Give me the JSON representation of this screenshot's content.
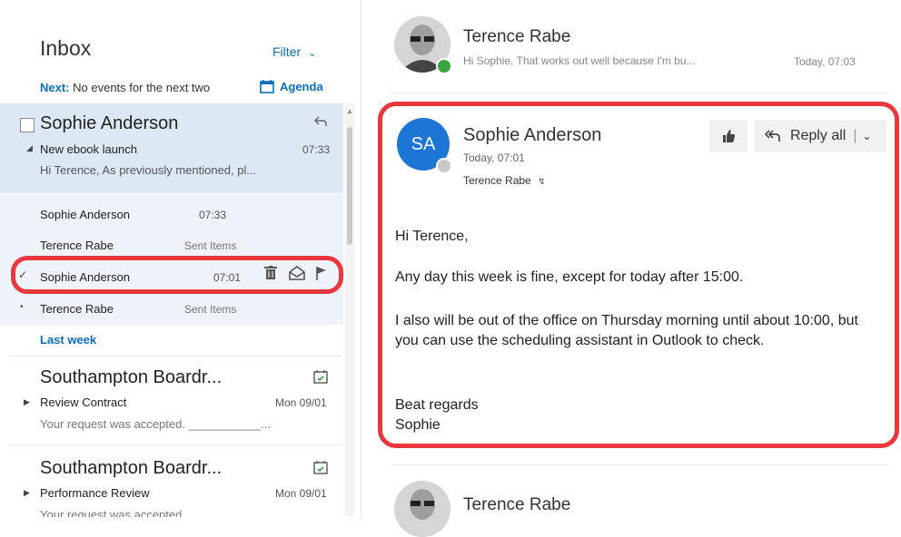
{
  "inbox": {
    "title": "Inbox",
    "filter_label": "Filter",
    "next_prefix": "Next:",
    "next_text": "No events for the next two",
    "agenda_label": "Agenda"
  },
  "conversation": {
    "sender": "Sophie Anderson",
    "subject": "New ebook launch",
    "time": "07:33",
    "preview": "Hi Terence,   As previously mentioned, pl...",
    "thread": [
      {
        "sender": "Sophie Anderson",
        "time": "07:33",
        "folder": ""
      },
      {
        "sender": "Terence Rabe",
        "time": "",
        "folder": "Sent Items"
      },
      {
        "sender": "Sophie Anderson",
        "time": "07:01",
        "folder": ""
      },
      {
        "sender": "Terence Rabe",
        "time": "",
        "folder": "Sent Items"
      }
    ]
  },
  "section_label": "Last week",
  "cards": [
    {
      "sender": "Southampton Boardr...",
      "subject": "Review Contract",
      "date": "Mon 09/01",
      "preview": "Your request was accepted. ___________..."
    },
    {
      "sender": "Southampton Boardr...",
      "subject": "Performance Review",
      "date": "Mon 09/01",
      "preview": "Your request was accepted"
    }
  ],
  "reading": {
    "top_message": {
      "sender": "Terence Rabe",
      "preview": "Hi Sophie, That works out well because I'm bu...",
      "date": "Today, 07:03"
    },
    "message": {
      "initials": "SA",
      "sender": "Sophie Anderson",
      "time": "Today, 07:01",
      "to": "Terence Rabe",
      "reply_all_label": "Reply all",
      "body": [
        "Hi Terence,",
        "Any day this week is fine, except for today after 15:00.",
        "I also will be out of the office on Thursday morning until about 10:00, but you can use the scheduling assistant in Outlook to check.",
        "Beat regards",
        "Sophie"
      ]
    },
    "bottom_message": {
      "sender": "Terence Rabe"
    }
  },
  "colors": {
    "accent": "#0b6ebd",
    "avatar_bg": "#1d76d6",
    "highlight": "#e8383d",
    "selected_bg": "#dce9f5",
    "presence": "#3aa53a"
  }
}
